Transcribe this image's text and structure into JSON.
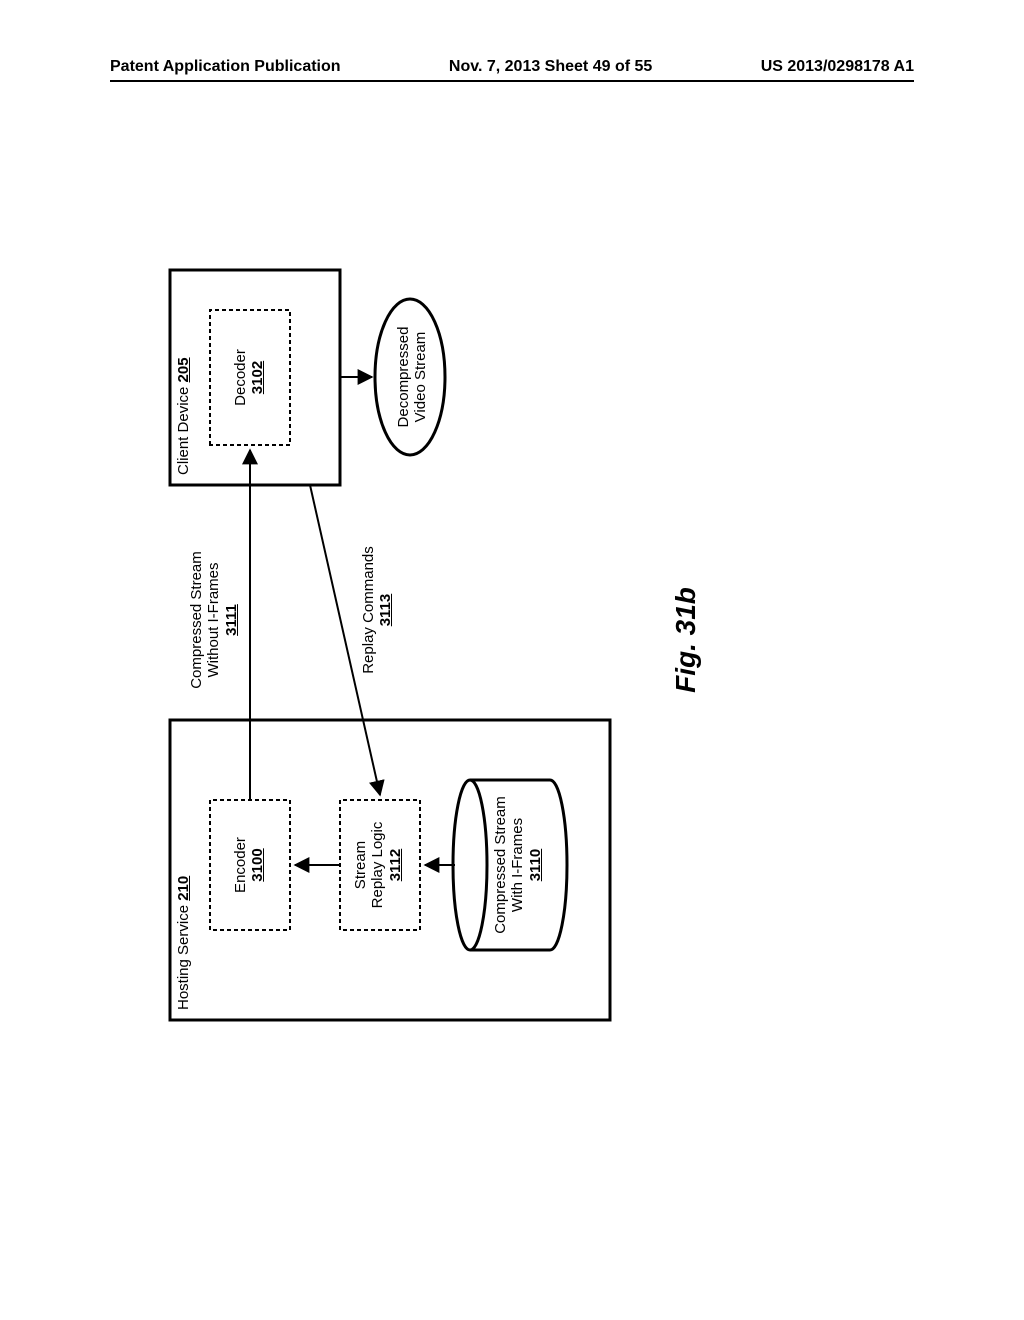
{
  "header": {
    "left": "Patent Application Publication",
    "mid": "Nov. 7, 2013   Sheet 49 of 55",
    "right": "US 2013/0298178 A1"
  },
  "figure": {
    "caption": "Fig. 31b",
    "hosting_service_label": "Hosting Service",
    "hosting_service_num": "210",
    "encoder_label": "Encoder",
    "encoder_num": "3100",
    "replay_logic_label1": "Stream",
    "replay_logic_label2": "Replay Logic",
    "replay_logic_num": "3112",
    "storage_label1": "Compressed Stream",
    "storage_label2": "With I-Frames",
    "storage_num": "3110",
    "client_device_label": "Client Device",
    "client_device_num": "205",
    "decoder_label": "Decoder",
    "decoder_num": "3102",
    "output_label1": "Decompressed",
    "output_label2": "Video Stream",
    "stream_label1": "Compressed Stream",
    "stream_label2": "Without I-Frames",
    "stream_num": "3111",
    "replay_cmd_label": "Replay Commands",
    "replay_cmd_num": "3113"
  }
}
